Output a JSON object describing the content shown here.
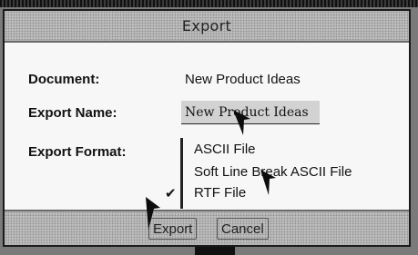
{
  "dialog": {
    "title": "Export",
    "document_label": "Document:",
    "document_value": "New Product Ideas",
    "export_name_label": "Export Name:",
    "export_name_value": "New Product Ideas",
    "export_format_label": "Export Format:",
    "formats": [
      {
        "label": "ASCII File",
        "selected": false
      },
      {
        "label": "Soft Line Break ASCII File",
        "selected": false
      },
      {
        "label": "RTF File",
        "selected": true
      }
    ],
    "selected_mark": "✔",
    "export_button": "Export",
    "cancel_button": "Cancel"
  },
  "icons": {
    "cursor": "arrow-pointer-icon",
    "check": "checkmark-icon"
  }
}
